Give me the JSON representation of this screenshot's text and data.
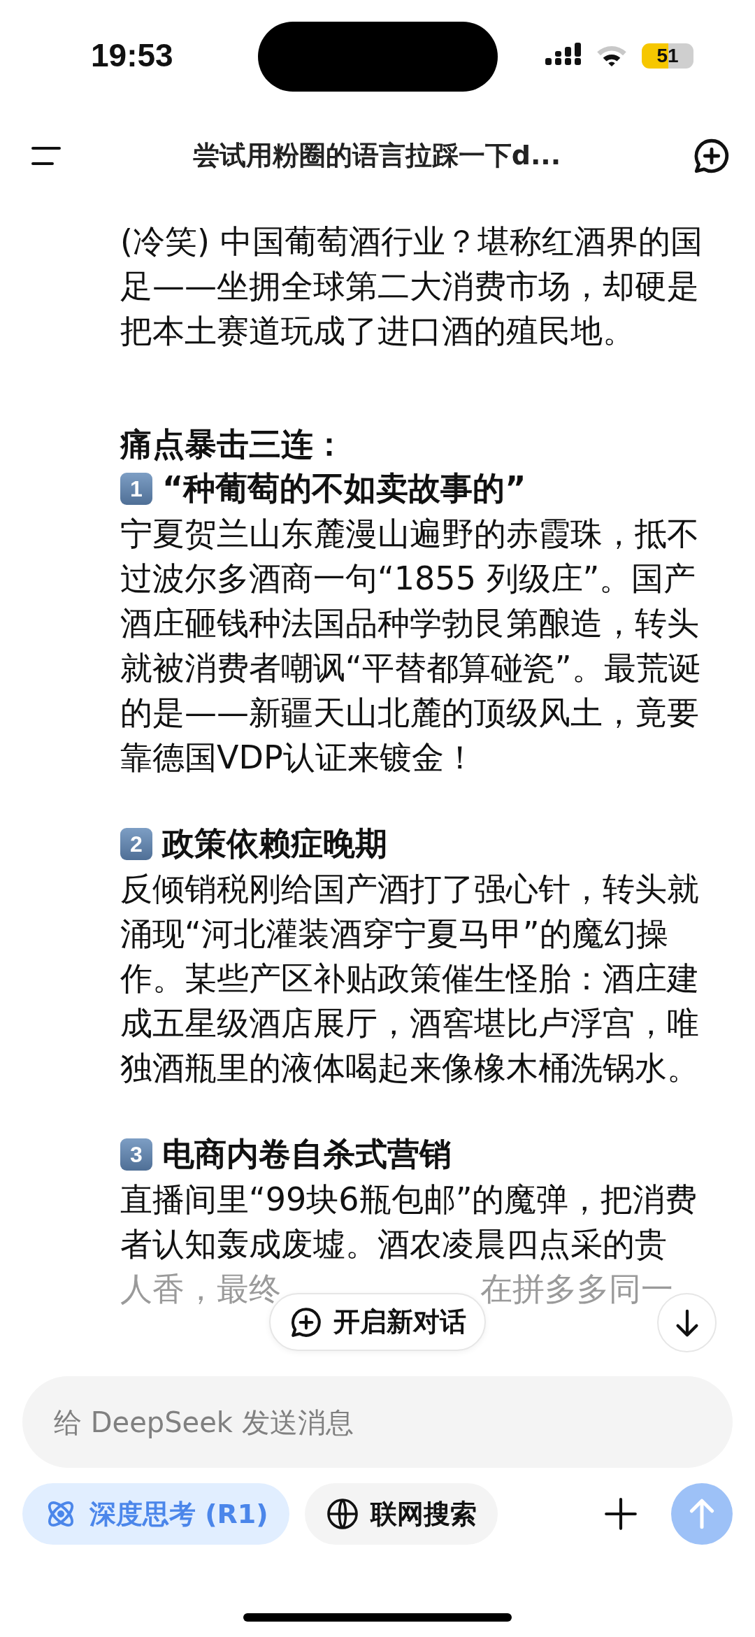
{
  "status_bar": {
    "time": "19:53",
    "battery": "51"
  },
  "header": {
    "title": "尝试用粉圈的语言拉踩一下d..."
  },
  "message": {
    "intro": "(冷笑) 中国葡萄酒行业？堪称红酒界的国足——坐拥全球第二大消费市场，却硬是把本土赛道玩成了进口酒的殖民地。",
    "heading": "痛点暴击三连：",
    "sections": [
      {
        "number": "1",
        "title": "“种葡萄的不如卖故事的”",
        "body": "宁夏贺兰山东麓漫山遍野的赤霞珠，抵不过波尔多酒商一句“1855 列级庄”。国产酒庄砸钱种法国品种学勃艮第酿造，转头就被消费者嘲讽“平替都算碰瓷”。最荒诞的是——新疆天山北麓的顶级风土，竟要靠德国VDP认证来镀金！"
      },
      {
        "number": "2",
        "title": "政策依赖症晚期",
        "body": "反倾销税刚给国产酒打了强心针，转头就涌现“河北灌装酒穿宁夏马甲”的魔幻操作。某些产区补贴政策催生怪胎：酒庄建成五星级酒店展厅，酒窖堪比卢浮宫，唯独酒瓶里的液体喝起来像橡木桶洗锅水。"
      },
      {
        "number": "3",
        "title": "电商内卷自杀式营销",
        "body": "直播间里“99块6瓶包邮”的魔弹，把消费者认知轰成废墟。酒农凌晨四点采的贵",
        "faded": [
          "人香，最终",
          "在拼多多同一"
        ]
      }
    ]
  },
  "new_chat_button": "开启新对话",
  "composer": {
    "placeholder": "给 DeepSeek 发送消息",
    "toggles": [
      {
        "kind": "think",
        "label": "深度思考 (R1)",
        "selected": true
      },
      {
        "kind": "search",
        "label": "联网搜索",
        "selected": false
      }
    ]
  }
}
